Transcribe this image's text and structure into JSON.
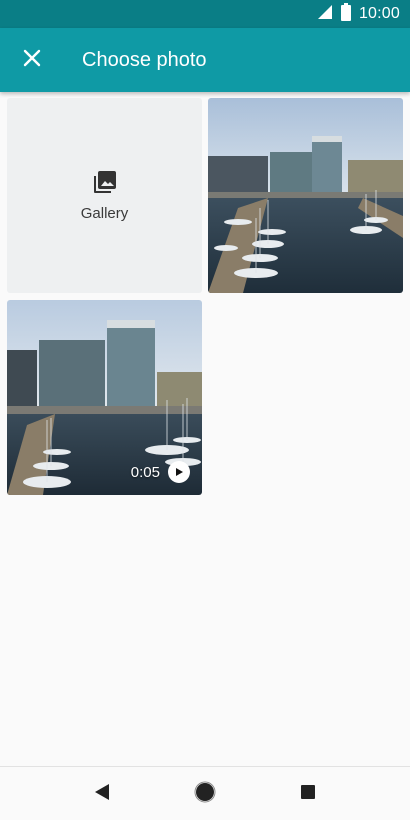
{
  "status_bar": {
    "time": "10:00",
    "icons": [
      "signal-icon",
      "battery-icon"
    ]
  },
  "app_bar": {
    "title": "Choose photo",
    "close_icon": "close-icon"
  },
  "grid": {
    "gallery": {
      "label": "Gallery",
      "icon": "photo-library-icon"
    },
    "photo": {
      "alt": ""
    },
    "video": {
      "duration": "0:05",
      "icon": "play-icon"
    }
  },
  "nav_bar": {
    "buttons": [
      "back-icon",
      "home-icon",
      "recents-icon"
    ]
  },
  "colors": {
    "status_bar": "#0a7e86",
    "app_bar": "#0f9aa5",
    "background": "#fafafa",
    "gallery_tile": "#eef0f1"
  }
}
